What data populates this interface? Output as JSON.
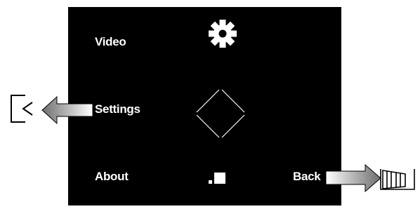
{
  "screen": {
    "background": "#000000",
    "text_color": "#ffffff"
  },
  "menu": {
    "items": [
      {
        "label": "Video"
      },
      {
        "label": "Settings"
      },
      {
        "label": "About"
      },
      {
        "label": "Back"
      }
    ]
  },
  "icons": {
    "settings": "gear-icon",
    "navigation": "diamond-dpad-icon",
    "about": "small-squares-icon",
    "left_control": "bracket-left-arrow-icon",
    "right_control": "grille-box-icon"
  },
  "callouts": {
    "settings_arrow": "left-pointing-gradient-arrow",
    "back_arrow": "right-pointing-gradient-arrow",
    "arrow_gradient": [
      "#ffffff",
      "#6e6e6e"
    ]
  }
}
